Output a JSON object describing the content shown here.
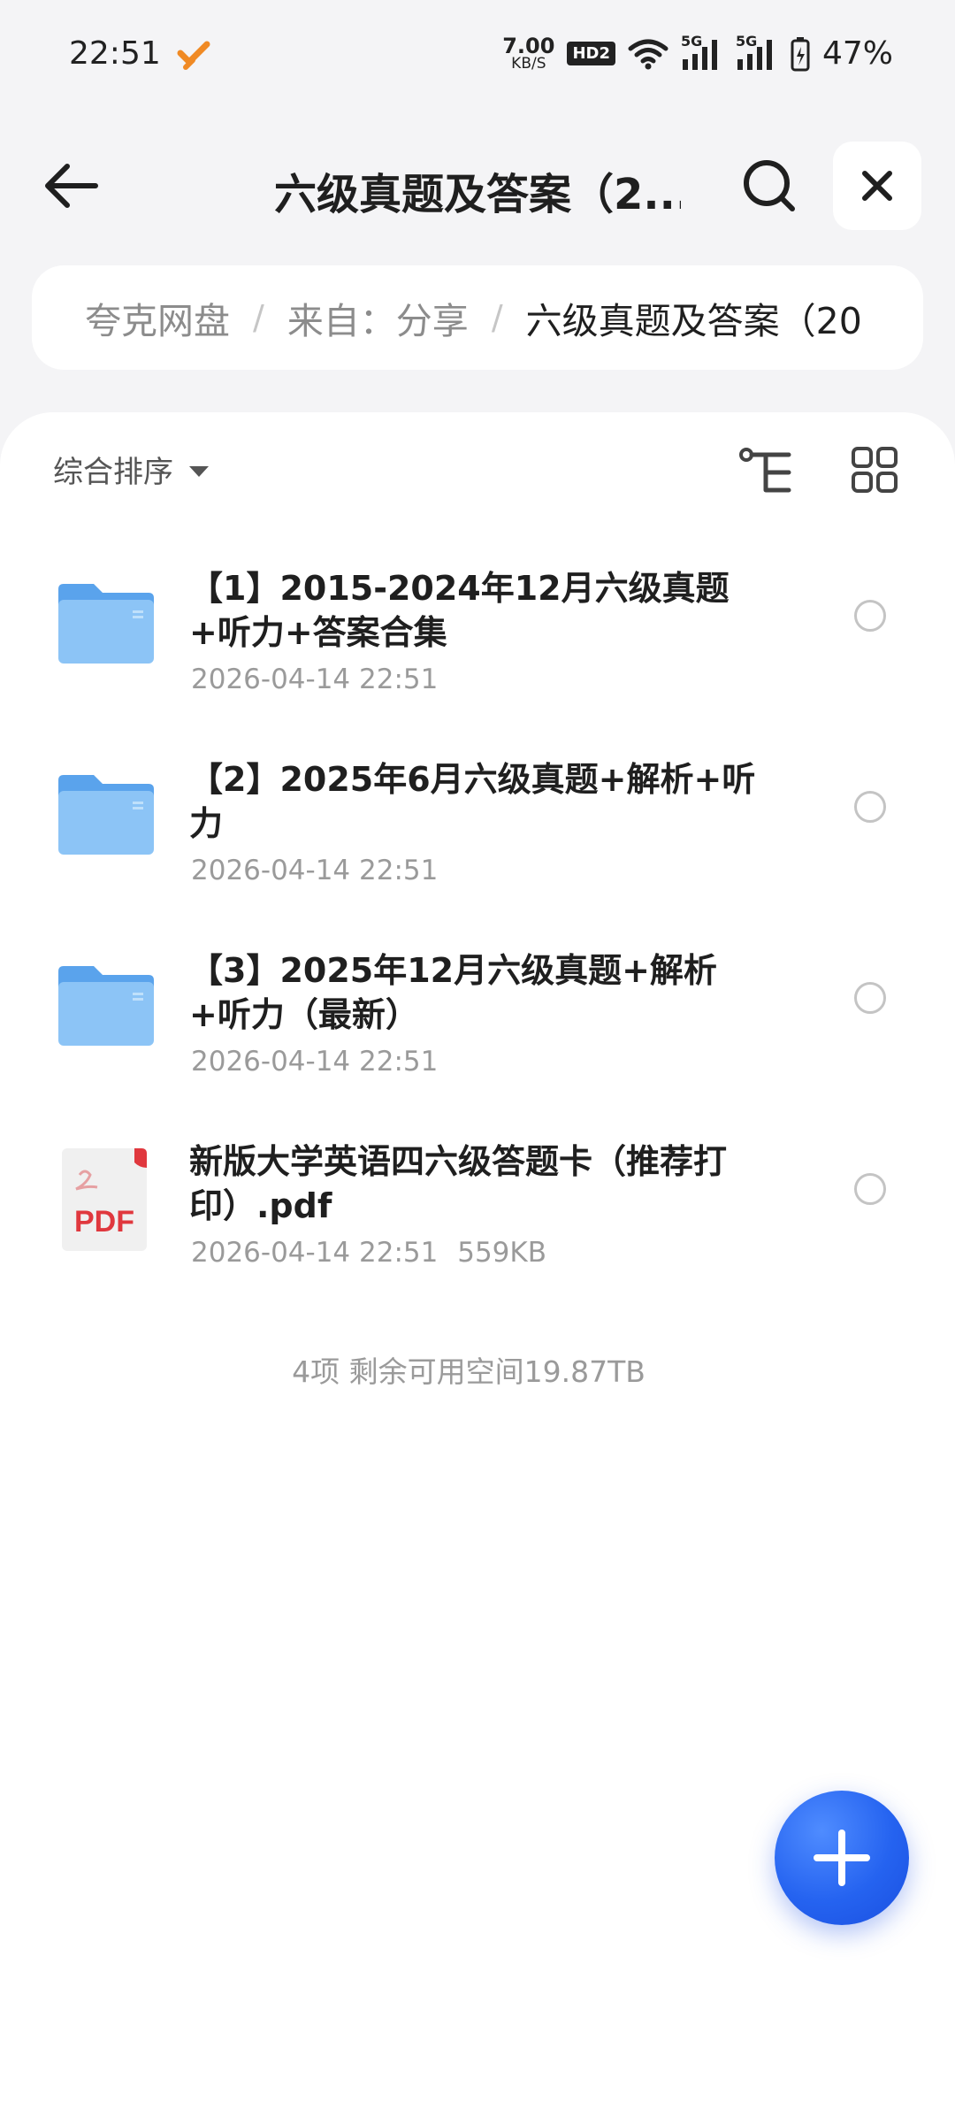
{
  "status_bar": {
    "time": "22:51",
    "net_speed_value": "7.00",
    "net_speed_unit": "KB/S",
    "hd_label": "HD2",
    "signal_1_label": "5G",
    "signal_2_label": "5G",
    "battery": "47%"
  },
  "header": {
    "title": "六级真题及答案（2..."
  },
  "breadcrumb": {
    "items": [
      "夸克网盘",
      "来自：分享",
      "六级真题及答案（20"
    ]
  },
  "toolbar": {
    "sort_label": "综合排序"
  },
  "files": [
    {
      "name": "【1】2015-2024年12月六级真题+听力+答案合集",
      "date": "2026-04-14 22:51",
      "size": "",
      "type": "folder"
    },
    {
      "name": "【2】2025年6月六级真题+解析+听力",
      "date": "2026-04-14 22:51",
      "size": "",
      "type": "folder"
    },
    {
      "name": "【3】2025年12月六级真题+解析+听力（最新）",
      "date": "2026-04-14 22:51",
      "size": "",
      "type": "folder"
    },
    {
      "name": "新版大学英语四六级答题卡（推荐打印）.pdf",
      "date": "2026-04-14 22:51",
      "size": "559KB",
      "type": "pdf",
      "icon_label": "PDF"
    }
  ],
  "footer": {
    "summary": "4项 剩余可用空间19.87TB"
  },
  "colors": {
    "accent": "#2563f0",
    "folder": "#6fb2f2",
    "pdf_red": "#e0383e"
  }
}
